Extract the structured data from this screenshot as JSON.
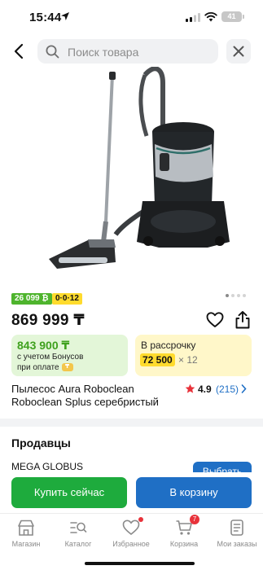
{
  "status_bar": {
    "time": "15:44",
    "battery": "41"
  },
  "search": {
    "placeholder": "Поиск товара"
  },
  "gallery": {
    "slides": 4,
    "active": 1
  },
  "badges": {
    "bonus": "26 099 ₿",
    "installment": "0·0·12"
  },
  "price": "869 999 ₸",
  "bonus_card": {
    "price": "843 900 ₸",
    "line1": "с учетом Бонусов",
    "line2": "при оплате",
    "coin": "₸"
  },
  "installment_card": {
    "title": "В рассрочку",
    "amount": "72 500",
    "multiplier": "× 12"
  },
  "product": {
    "title": "Пылесос Aura Roboclean Roboclean Splus серебристый"
  },
  "rating": {
    "value": "4.9",
    "count": "(215)"
  },
  "sellers": {
    "title": "Продавцы",
    "first_seller": "MEGA GLOBUS",
    "choose_label": "Выбрать"
  },
  "actions": {
    "buy_now": "Купить сейчас",
    "add_to_cart": "В корзину"
  },
  "tabbar": {
    "items": [
      {
        "label": "Магазин",
        "icon": "shop-icon"
      },
      {
        "label": "Каталог",
        "icon": "catalog-search-icon"
      },
      {
        "label": "Избранное",
        "icon": "heart-icon"
      },
      {
        "label": "Корзина",
        "icon": "cart-icon",
        "badge": "7"
      },
      {
        "label": "Мои заказы",
        "icon": "orders-icon"
      }
    ]
  },
  "colors": {
    "accent_blue": "#1f6fc5",
    "buy_green": "#1eab3d",
    "bonus_green": "#4eb42d",
    "installment_yellow": "#ffdb2d",
    "badge_red": "#e8323a"
  }
}
